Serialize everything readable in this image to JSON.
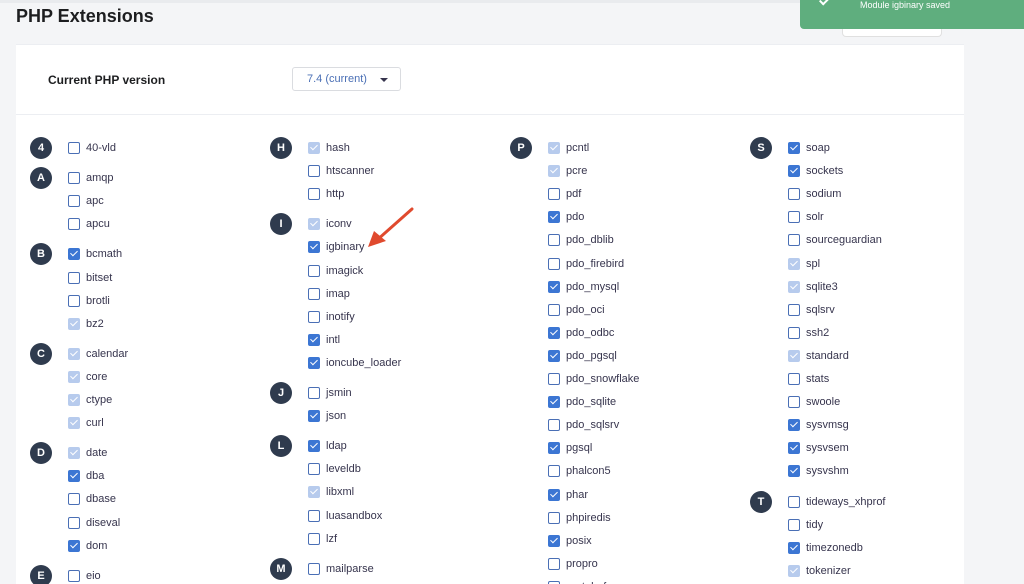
{
  "page": {
    "title": "PHP Extensions"
  },
  "toast": {
    "message": "Module igbinary saved"
  },
  "version": {
    "label": "Current PHP version",
    "selected": "7.4 (current)"
  },
  "colors": {
    "accent": "#3c76d3",
    "toast": "#5fae7e",
    "badge": "#2f3b4e",
    "annotation_arrow": "#e04a2e"
  },
  "columns": [
    {
      "groups": [
        {
          "letter": "4",
          "items": [
            {
              "name": "40-vld",
              "state": "unchecked"
            }
          ]
        },
        {
          "letter": "A",
          "items": [
            {
              "name": "amqp",
              "state": "unchecked"
            },
            {
              "name": "apc",
              "state": "unchecked"
            },
            {
              "name": "apcu",
              "state": "unchecked"
            }
          ]
        },
        {
          "letter": "B",
          "items": [
            {
              "name": "bcmath",
              "state": "checked"
            },
            {
              "name": "bitset",
              "state": "unchecked"
            },
            {
              "name": "brotli",
              "state": "unchecked"
            },
            {
              "name": "bz2",
              "state": "locked"
            }
          ]
        },
        {
          "letter": "C",
          "items": [
            {
              "name": "calendar",
              "state": "locked"
            },
            {
              "name": "core",
              "state": "locked"
            },
            {
              "name": "ctype",
              "state": "locked"
            },
            {
              "name": "curl",
              "state": "locked"
            }
          ]
        },
        {
          "letter": "D",
          "items": [
            {
              "name": "date",
              "state": "locked"
            },
            {
              "name": "dba",
              "state": "checked"
            },
            {
              "name": "dbase",
              "state": "unchecked"
            },
            {
              "name": "diseval",
              "state": "unchecked"
            },
            {
              "name": "dom",
              "state": "checked"
            }
          ]
        },
        {
          "letter": "E",
          "items": [
            {
              "name": "eio",
              "state": "unchecked"
            }
          ]
        }
      ]
    },
    {
      "groups": [
        {
          "letter": "H",
          "items": [
            {
              "name": "hash",
              "state": "locked"
            },
            {
              "name": "htscanner",
              "state": "unchecked"
            },
            {
              "name": "http",
              "state": "unchecked"
            }
          ]
        },
        {
          "letter": "I",
          "items": [
            {
              "name": "iconv",
              "state": "locked"
            },
            {
              "name": "igbinary",
              "state": "checked"
            },
            {
              "name": "imagick",
              "state": "unchecked"
            },
            {
              "name": "imap",
              "state": "unchecked"
            },
            {
              "name": "inotify",
              "state": "unchecked"
            },
            {
              "name": "intl",
              "state": "checked"
            },
            {
              "name": "ioncube_loader",
              "state": "checked"
            }
          ]
        },
        {
          "letter": "J",
          "items": [
            {
              "name": "jsmin",
              "state": "unchecked"
            },
            {
              "name": "json",
              "state": "checked"
            }
          ]
        },
        {
          "letter": "L",
          "items": [
            {
              "name": "ldap",
              "state": "checked"
            },
            {
              "name": "leveldb",
              "state": "unchecked"
            },
            {
              "name": "libxml",
              "state": "locked"
            },
            {
              "name": "luasandbox",
              "state": "unchecked"
            },
            {
              "name": "lzf",
              "state": "unchecked"
            }
          ]
        },
        {
          "letter": "M",
          "items": [
            {
              "name": "mailparse",
              "state": "unchecked"
            }
          ]
        }
      ]
    },
    {
      "groups": [
        {
          "letter": "P",
          "items": [
            {
              "name": "pcntl",
              "state": "locked"
            },
            {
              "name": "pcre",
              "state": "locked"
            },
            {
              "name": "pdf",
              "state": "unchecked"
            },
            {
              "name": "pdo",
              "state": "checked"
            },
            {
              "name": "pdo_dblib",
              "state": "unchecked"
            },
            {
              "name": "pdo_firebird",
              "state": "unchecked"
            },
            {
              "name": "pdo_mysql",
              "state": "checked"
            },
            {
              "name": "pdo_oci",
              "state": "unchecked"
            },
            {
              "name": "pdo_odbc",
              "state": "checked"
            },
            {
              "name": "pdo_pgsql",
              "state": "checked"
            },
            {
              "name": "pdo_snowflake",
              "state": "unchecked"
            },
            {
              "name": "pdo_sqlite",
              "state": "checked"
            },
            {
              "name": "pdo_sqlsrv",
              "state": "unchecked"
            },
            {
              "name": "pgsql",
              "state": "checked"
            },
            {
              "name": "phalcon5",
              "state": "unchecked"
            },
            {
              "name": "phar",
              "state": "checked"
            },
            {
              "name": "phpiredis",
              "state": "unchecked"
            },
            {
              "name": "posix",
              "state": "checked"
            },
            {
              "name": "propro",
              "state": "unchecked"
            },
            {
              "name": "protobuf",
              "state": "unchecked"
            }
          ]
        }
      ]
    },
    {
      "groups": [
        {
          "letter": "S",
          "items": [
            {
              "name": "soap",
              "state": "checked"
            },
            {
              "name": "sockets",
              "state": "checked"
            },
            {
              "name": "sodium",
              "state": "unchecked"
            },
            {
              "name": "solr",
              "state": "unchecked"
            },
            {
              "name": "sourceguardian",
              "state": "unchecked"
            },
            {
              "name": "spl",
              "state": "locked"
            },
            {
              "name": "sqlite3",
              "state": "locked"
            },
            {
              "name": "sqlsrv",
              "state": "unchecked"
            },
            {
              "name": "ssh2",
              "state": "unchecked"
            },
            {
              "name": "standard",
              "state": "locked"
            },
            {
              "name": "stats",
              "state": "unchecked"
            },
            {
              "name": "swoole",
              "state": "unchecked"
            },
            {
              "name": "sysvmsg",
              "state": "checked"
            },
            {
              "name": "sysvsem",
              "state": "checked"
            },
            {
              "name": "sysvshm",
              "state": "checked"
            }
          ]
        },
        {
          "letter": "T",
          "items": [
            {
              "name": "tideways_xhprof",
              "state": "unchecked"
            },
            {
              "name": "tidy",
              "state": "unchecked"
            },
            {
              "name": "timezonedb",
              "state": "checked"
            },
            {
              "name": "tokenizer",
              "state": "locked"
            }
          ]
        }
      ]
    }
  ]
}
